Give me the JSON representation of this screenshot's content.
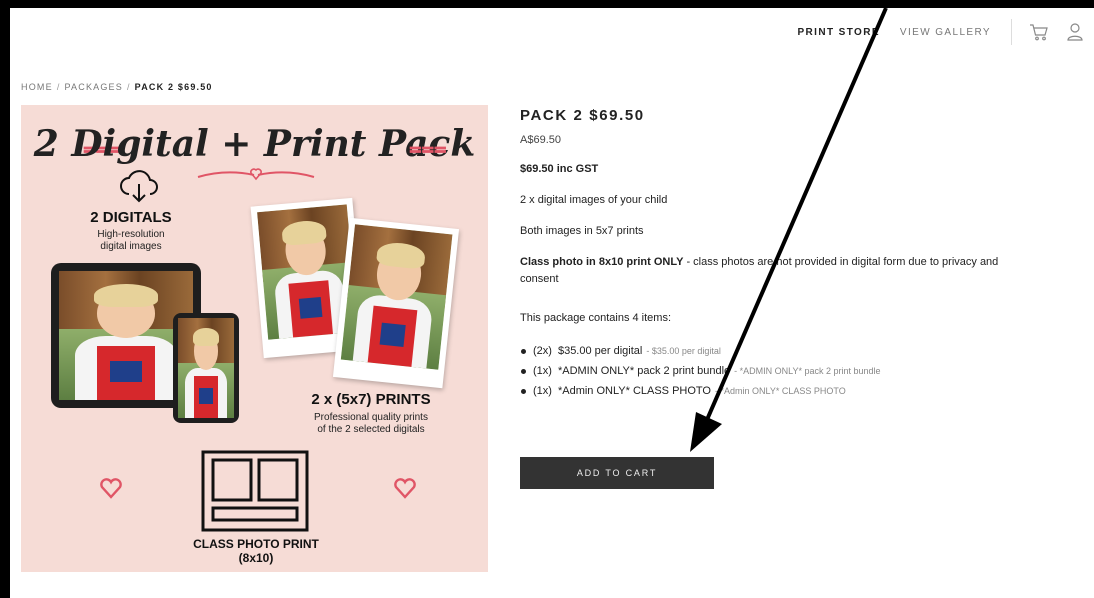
{
  "nav": {
    "print_store": "PRINT STORE",
    "view_gallery": "VIEW GALLERY",
    "cart_icon": "cart-icon",
    "account_icon": "user-icon"
  },
  "breadcrumb": {
    "home": "HOME",
    "packages": "PACKAGES",
    "current": "PACK 2 $69.50",
    "separator": "/"
  },
  "product_image": {
    "title": "2 Digital + Print Pack",
    "digitals_heading": "2 DIGITALS",
    "digitals_sub_1": "High-resolution",
    "digitals_sub_2": "digital images",
    "prints_heading": "2 x (5x7) PRINTS",
    "prints_sub_1": "Professional quality prints",
    "prints_sub_2": "of the 2 selected digitals",
    "class_label_1": "CLASS PHOTO PRINT",
    "class_label_2": "(8x10)"
  },
  "product": {
    "title": "PACK 2 $69.50",
    "price": "A$69.50",
    "line_gst": "$69.50 inc GST",
    "line_digital": "2 x digital images of your child",
    "line_prints": "Both images in 5x7 prints",
    "class_bold": "Class photo in 8x10 print ONLY",
    "class_rest": " -  class photos are not provided in digital form due to privacy and consent",
    "contains": "This package contains 4 items:",
    "items": [
      {
        "qty": "(2x)",
        "name": "$35.00 per digital",
        "sub": "- $35.00 per digital"
      },
      {
        "qty": "(1x)",
        "name": "*ADMIN ONLY* pack 2 print bundle",
        "sub": "- *ADMIN ONLY* pack 2 print bundle"
      },
      {
        "qty": "(1x)",
        "name": "*Admin ONLY* CLASS PHOTO",
        "sub": "- *Admin ONLY* CLASS PHOTO"
      }
    ],
    "add_to_cart": "ADD TO CART"
  },
  "colors": {
    "image_bg": "#f6dcd6",
    "accent_red": "#e05566",
    "button_bg": "#333333"
  }
}
